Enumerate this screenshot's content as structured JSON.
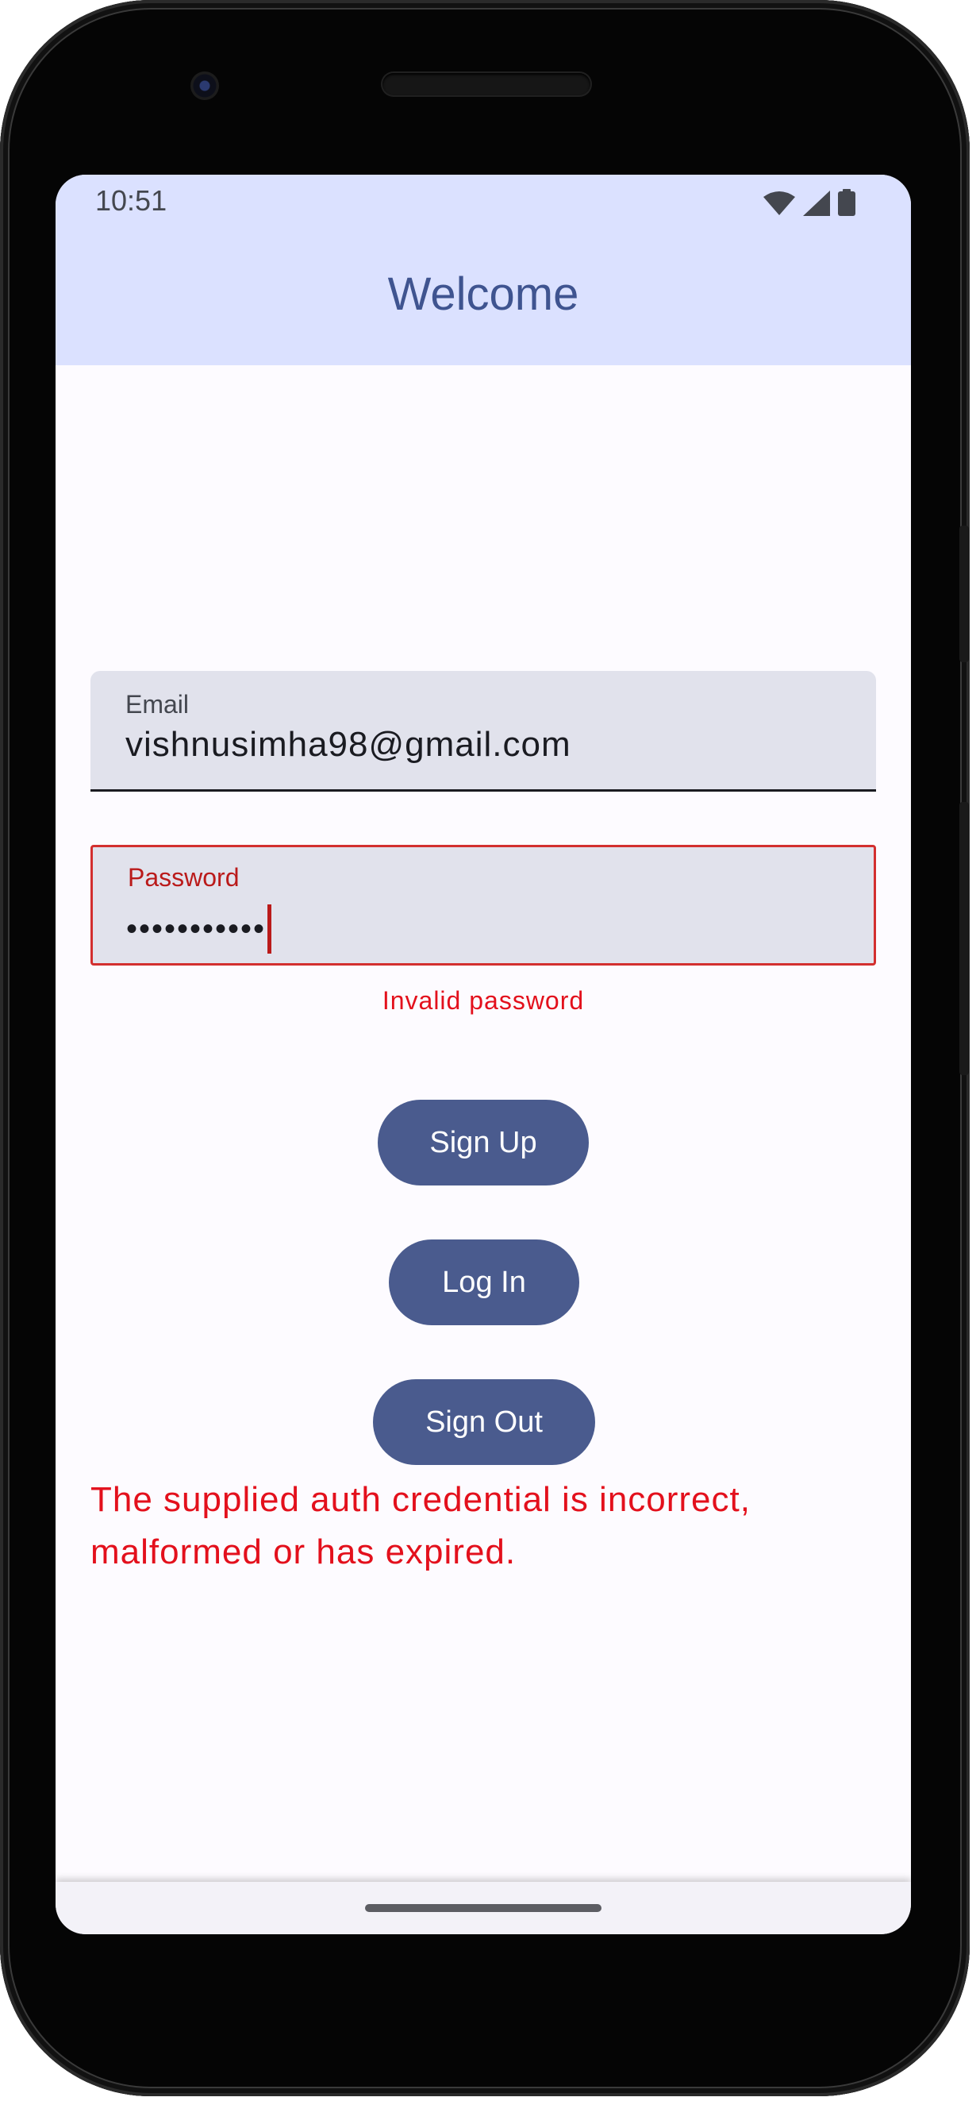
{
  "status_bar": {
    "time": "10:51",
    "icons": [
      "wifi-icon",
      "signal-icon",
      "battery-icon"
    ]
  },
  "app_bar": {
    "title": "Welcome"
  },
  "email_field": {
    "label": "Email",
    "value": "vishnusimha98@gmail.com"
  },
  "password_field": {
    "label": "Password",
    "value": "•••••••••••",
    "error": "Invalid password"
  },
  "buttons": {
    "sign_up": "Sign Up",
    "log_in": "Log In",
    "sign_out": "Sign Out"
  },
  "auth_error": "The supplied auth credential is incorrect, malformed or has expired.",
  "colors": {
    "app_bar_bg": "#dbe1ff",
    "title": "#3f5490",
    "button_bg": "#4a5b8e",
    "error": "#e3101c",
    "field_bg": "#e1e2ec"
  }
}
